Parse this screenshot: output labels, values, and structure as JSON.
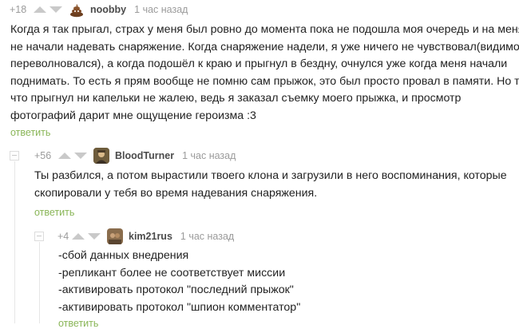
{
  "comments": [
    {
      "rating": "+18",
      "author": "noobby",
      "time": "1 час назад",
      "lines": [
        "Когда я так прыгал, страх у меня был ровно до момента пока не подошла моя очередь и на меня",
        "не начали надевать снаряжение. Когда снаряжение надели, я уже ничего не чувствовал(видимо",
        "переволновался), а когда подошёл к краю и прыгнул в бездну, очнулся уже когда меня начали",
        "поднимать. То есть я прям вообще не помню сам прыжок, это был просто провал в памяти. Но то",
        "что прыгнул ни капельки не жалею, ведь я заказал съемку моего прыжка, и просмотр",
        "фотографий дарит мне ощущение героизма :3"
      ],
      "reply_label": "ответить",
      "avatar_icon": "poop-emoji-icon"
    },
    {
      "rating": "+56",
      "author": "BloodTurner",
      "time": "1 час назад",
      "lines": [
        "Ты  разбился, а потом вырастили твоего клона и загрузили в него воспоминания, которые",
        "скопировали у тебя во время надевания снаряжения."
      ],
      "reply_label": "ответить",
      "avatar_icon": "user-avatar-icon"
    },
    {
      "rating": "+4",
      "author": "kim21rus",
      "time": "1 час назад",
      "lines": [
        "-сбой данных внедрения",
        "-репликант более не соответствует миссии",
        "-активировать протокол \"последний прыжок\"",
        "-активировать протокол \"шпион комментатор\""
      ],
      "reply_label": "ответить",
      "avatar_icon": "user-avatar-icon"
    }
  ],
  "colors": {
    "reply_link": "#8ab658",
    "meta_text": "#9b9b9b",
    "vote_arrow": "#c9c9c9"
  }
}
